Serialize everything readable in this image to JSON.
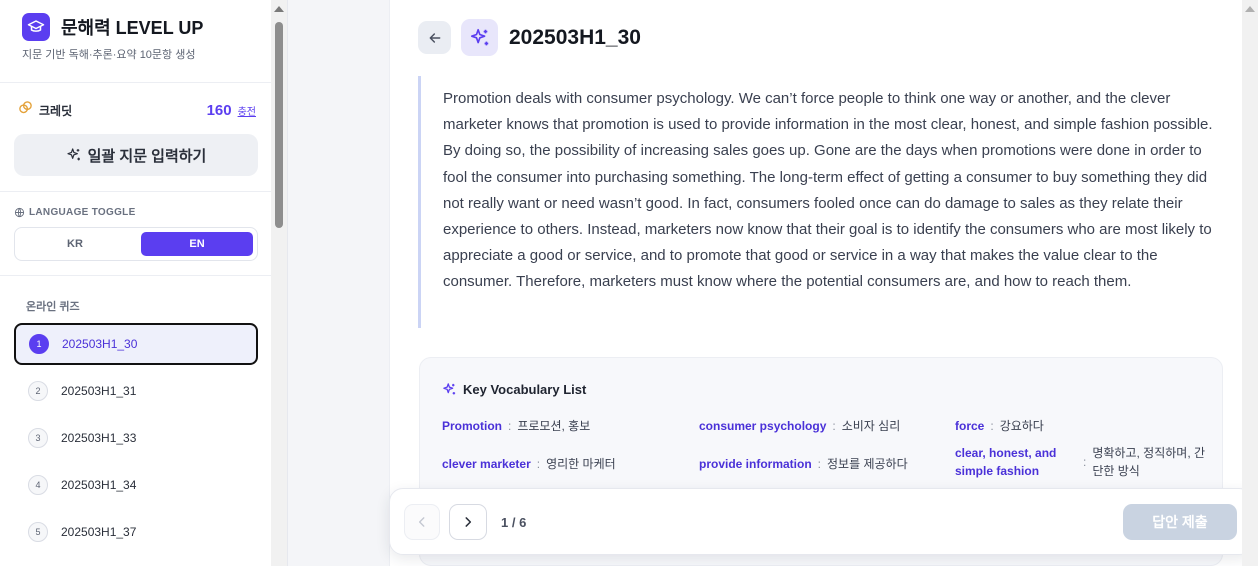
{
  "sidebar": {
    "brand_title": "문해력 LEVEL UP",
    "brand_subtitle": "지문 기반 독해·추론·요약 10문항 생성",
    "credit_label": "크레딧",
    "credit_value": "160",
    "credit_charge": "충전",
    "bulk_button": "일괄 지문 입력하기",
    "language_title": "LANGUAGE TOGGLE",
    "lang_kr": "KR",
    "lang_en": "EN",
    "quiz_title": "온라인 퀴즈",
    "quizzes": [
      {
        "num": "1",
        "label": "202503H1_30",
        "active": true
      },
      {
        "num": "2",
        "label": "202503H1_31"
      },
      {
        "num": "3",
        "label": "202503H1_33"
      },
      {
        "num": "4",
        "label": "202503H1_34"
      },
      {
        "num": "5",
        "label": "202503H1_37"
      }
    ]
  },
  "main": {
    "title": "202503H1_30",
    "passage": "Promotion deals with consumer psychology. We can’t force people to think one way or another, and the clever marketer knows that promotion is used to provide information in the most clear, honest, and simple fashion possible. By doing so, the possibility of increasing sales goes up. Gone are the days when promotions were done in order to fool the consumer into purchasing something. The long-term effect of getting a consumer to buy something they did not really want or need wasn’t good. In fact, consumers fooled once can do damage to sales as they relate their experience to others. Instead, marketers now know that their goal is to identify the consumers who are most likely to appreciate a good or service, and to promote that good or service in a way that makes the value clear to the consumer. Therefore, marketers must know where the potential consumers are, and how to reach them.",
    "vocab_title": "Key Vocabulary List",
    "vocab": [
      {
        "term": "Promotion",
        "def": "프로모션, 홍보"
      },
      {
        "term": "consumer psychology",
        "def": "소비자 심리"
      },
      {
        "term": "force",
        "def": "강요하다"
      },
      {
        "term": "clever marketer",
        "def": "영리한 마케터"
      },
      {
        "term": "provide information",
        "def": "정보를 제공하다"
      },
      {
        "term": "clear, honest, and simple fashion",
        "def": "명확하고, 정직하며, 간단한 방식"
      }
    ],
    "separator": ":"
  },
  "nav": {
    "page": "1 / 6",
    "submit": "답안 제출"
  },
  "colors": {
    "accent": "#5b3ef0",
    "submit_disabled": "#c9d3e1"
  }
}
